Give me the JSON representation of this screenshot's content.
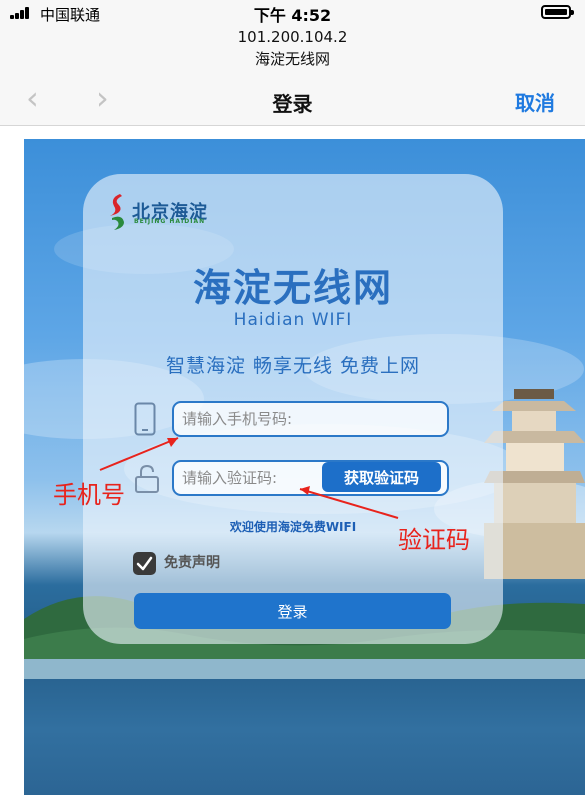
{
  "status_bar": {
    "carrier": "中国联通",
    "time": "下午 4:52"
  },
  "browser": {
    "url_ip": "101.200.104.2",
    "site_name": "海淀无线网",
    "back_icon": "chevron-left-icon",
    "forward_icon": "chevron-right-icon",
    "title": "登录",
    "cancel_label": "取消"
  },
  "card": {
    "logo_text": "北京海淀",
    "logo_sub": "BEIJING  HAIDIAN",
    "title": "海淀无线网",
    "subtitle": "Haidian  WIFI",
    "slogan": "智慧海淀 畅享无线 免费上网",
    "phone_placeholder": "请输入手机号码:",
    "code_placeholder": "请输入验证码:",
    "get_code_label": "获取验证码",
    "welcome_text": "欢迎使用海淀免费WIFI",
    "agreement_label": "免责声明",
    "agreement_checked": true,
    "login_label": "登录"
  },
  "annotations": {
    "phone": "手机号",
    "code": "验证码",
    "color": "#e8231c"
  },
  "colors": {
    "accent": "#1f74cc",
    "title_blue": "#2a6fbf",
    "cancel_blue": "#1f7ae0"
  }
}
